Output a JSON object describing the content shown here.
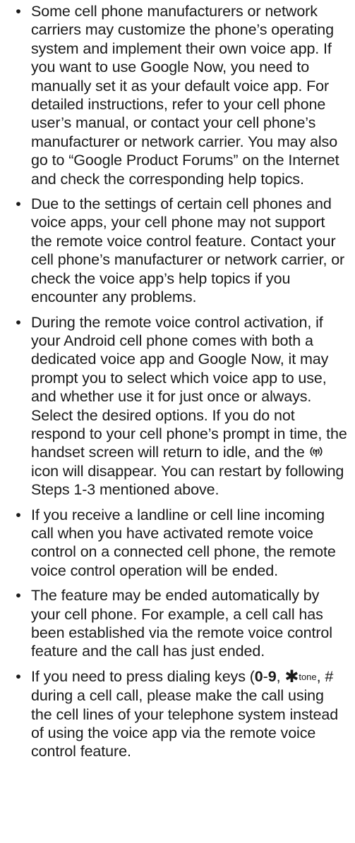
{
  "notes": {
    "bullet_glyph": "•",
    "item1": {
      "text": "Some cell phone manufacturers or network carriers may customize the phone’s operating system and implement their own voice app. If you want to use Google Now, you need to manually set it as your default voice app. For detailed instructions, refer to your cell phone user’s manual, or contact your cell phone’s manufacturer or network carrier. You may also go to “Google Product Forums” on the Internet and check the corresponding help topics."
    },
    "item2": {
      "text": "Due to the settings of certain cell phones and voice apps, your cell phone may not support the remote voice control feature. Contact your cell phone’s manufacturer or network carrier, or check the voice app’s help topics if you encounter any problems."
    },
    "item3": {
      "text_before_icon": "During the remote voice control activation, if your Android cell phone comes with both a dedicated voice app and Google Now, it may prompt you to select which voice app to use, and whether use it for just once or always. Select the desired options. If you do not respond to your cell phone’s prompt in time, the handset screen will return to idle, and the",
      "icon": "wireless-signal-icon",
      "text_after_icon": "icon will disappear. You can restart by following Steps 1-3 mentioned above."
    },
    "item4": {
      "text": "If you receive a landline or cell line incoming call when you have activated remote voice control on a connected cell phone, the remote voice control operation will be ended."
    },
    "item5": {
      "text": "The feature may be ended automatically by your cell phone. For example, a cell call has been established via the remote voice control feature and the call has just ended."
    },
    "item6": {
      "text_before_keys": "If you need to press dialing keys (",
      "key_0": "0",
      "dash": "-",
      "key_9": "9",
      "comma1": ",",
      "star_glyph": "✱",
      "star_label": "tone",
      "comma2": ",",
      "hash_key": "#",
      "text_after_keys": "during a cell call, please make the call using the cell lines of your telephone system instead of using the voice app via the remote voice control feature."
    }
  }
}
